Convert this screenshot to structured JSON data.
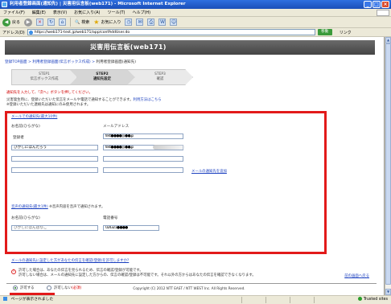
{
  "window": {
    "title": "利用者登録画面(通知先) | 災害用伝言板(web171) - Microsoft Internet Explorer",
    "controls": [
      "_",
      "□",
      "×"
    ]
  },
  "menubar": {
    "items": [
      "ファイル(F)",
      "編集(E)",
      "表示(V)",
      "お気に入り(A)",
      "ツール(T)",
      "ヘルプ(H)"
    ]
  },
  "toolbar": {
    "back_label": "戻る",
    "search_label": "検索",
    "favorites_label": "お気に入り"
  },
  "address": {
    "label": "アドレス(D)",
    "url": "https://web171-test.jp/web171/app/confAddUser.do",
    "go_label": "移動",
    "links_label": "リンク"
  },
  "page": {
    "banner_title": "災害用伝言板(web171)",
    "breadcrumb": {
      "link1": "登録TOP画面",
      "sep1": " > ",
      "link2": "利用者登録画面(伝言ボックス作成)",
      "sep2": " > ",
      "current": "利用者登録画面(通知先)"
    },
    "steps": [
      {
        "line1": "STEP1",
        "line2": "伝言ボックス作成"
      },
      {
        "line1": "STEP2",
        "line2": "通知先設定"
      },
      {
        "line1": "STEP3",
        "line2": "確認"
      }
    ],
    "note_red": "通知先を入力して、「次へ」ボタンを押してください。",
    "desc1_text": "災害発生時に、登録いただいた伝言をメールや電話で通知することができます。",
    "desc1_link": "利用方法はこちら",
    "desc2": "※登録いただいた連絡先は通知にのみ使用されます。",
    "mail_section": {
      "title": "メールでの通知先(最大10件)",
      "col_name": "お名前(ひらがな)",
      "col_email": "メールアドレス",
      "rows": [
        {
          "name": "登録者",
          "email": "test●●●●@●●.jp",
          "name_is_label": true
        },
        {
          "name": "ひがしにほんたろう",
          "email": "test●●●●@●●.jp",
          "name_is_label": false
        },
        {
          "name": "",
          "email": "",
          "name_is_label": false
        },
        {
          "name": "",
          "email": "",
          "name_is_label": false
        }
      ],
      "add_link": "メールの通知先を追加"
    },
    "voice_section": {
      "title": "音声の通知先(最大1件)",
      "note": "※音声内容を音声で通知されます。",
      "col_name": "お名前(ひらがな)",
      "col_phone": "電話番号",
      "name_value": "ひがしにほんはなこ",
      "phone_value": "024321●●●●"
    },
    "confirm_section": {
      "title": "メールの通知先に設定した方があなたの伝言を確認(登録)を許可しますか?",
      "note_line1": "許可した場合は、あなたの伝言を見られるため、伝言の確認/登録が可能です。",
      "note_line2": "許可しない場合は、メールの通知先に設定した方からの、伝言の確認/登録は不可能です。それ以外の方からはあなたの伝言を確認できなくなります。",
      "option_allow": "許可する",
      "option_deny": "許可しない",
      "required_mark": "(必須)"
    },
    "buttons": {
      "next": "次へ",
      "back": "戻る"
    },
    "back_to_top": "前の画面へ戻る",
    "footer": "Copyright (C) 2012 NTT EAST / NTT WEST Inc. All Rights Reserved."
  },
  "statusbar": {
    "text": "ページが表示されました",
    "zone": "Trusted sites"
  },
  "colors": {
    "highlight_red": "#e21a1a",
    "banner_gray": "#555555",
    "link_blue": "#1a3fbf",
    "alert_red": "#d00000"
  }
}
